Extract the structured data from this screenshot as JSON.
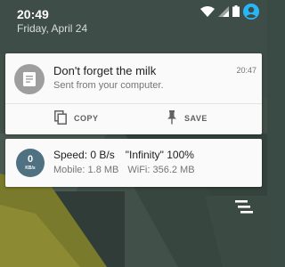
{
  "status_bar": {
    "time": "20:49",
    "date": "Friday, April 24",
    "icons": [
      "wifi-icon",
      "signal-icon",
      "battery-icon",
      "user-avatar-icon"
    ],
    "accent_color": "#29b6f6"
  },
  "notifications": [
    {
      "app_icon": "document-icon",
      "title": "Don't forget the milk",
      "text": "Sent from your computer.",
      "time": "20:47",
      "actions": [
        {
          "icon": "copy-icon",
          "label": "COPY"
        },
        {
          "icon": "pin-icon",
          "label": "SAVE"
        }
      ]
    },
    {
      "icon_value": "0",
      "icon_unit": "KB/s",
      "speed_label": "Speed: 0 B/s",
      "speed_extra": "\"Infinity\" 100%",
      "mobile_label": "Mobile: 1.8 MB",
      "wifi_label": "WiFi: 356.2 MB",
      "icon_color": "#4f7182"
    }
  ],
  "clear_all_icon": "clear-all-icon"
}
